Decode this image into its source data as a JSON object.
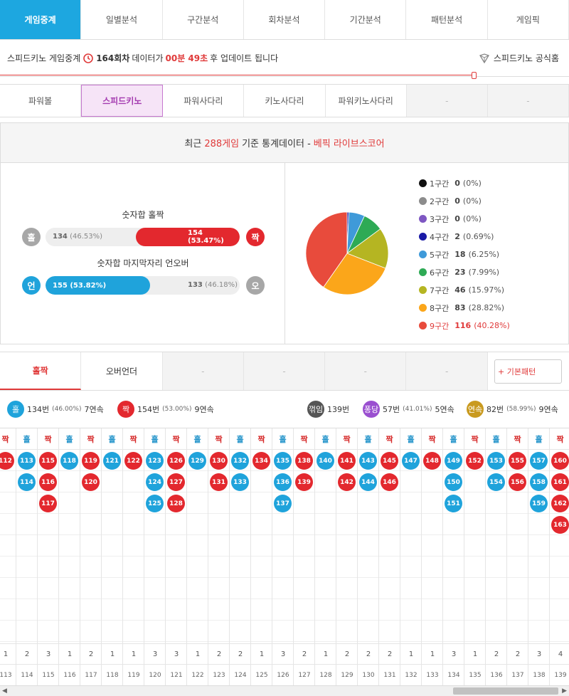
{
  "topnav": [
    "게임중계",
    "일별분석",
    "구간분석",
    "회차분석",
    "기간분석",
    "패턴분석",
    "게임픽"
  ],
  "info": {
    "prefix": "스피드키노 게임중계",
    "round": "164회차",
    "mid": "데이터가",
    "time": "00분 49초",
    "suffix": "후 업데이트 됩니다",
    "link": "스피드키노 공식홈"
  },
  "gamenav": [
    "파워볼",
    "스피드키노",
    "파워사다리",
    "키노사다리",
    "파워키노사다리",
    "-",
    "-"
  ],
  "stat": {
    "head_pre": "최근",
    "games": "288게임",
    "head_mid": "기준 통계데이터 -",
    "brand": "베픽 라이브스코어",
    "bar1": {
      "title": "숫자합 홀짝",
      "left_label": "홀",
      "right_label": "짝",
      "left_text": "134",
      "left_pct": "(46.53%)",
      "right_text": "154 (53.47%)",
      "right_fraction": 0.5347
    },
    "bar2": {
      "title": "숫자합 마지막자리 언오버",
      "left_label": "언",
      "right_label": "오",
      "left_text": "155 (53.82%)",
      "left_fraction": 0.5382,
      "right_text": "133",
      "right_pct": "(46.18%)"
    }
  },
  "chart_data": {
    "type": "pie",
    "categories": [
      "1구간",
      "2구간",
      "3구간",
      "4구간",
      "5구간",
      "6구간",
      "7구간",
      "8구간",
      "9구간"
    ],
    "values": [
      0,
      0,
      0,
      2,
      18,
      23,
      46,
      83,
      116
    ],
    "percent_labels": [
      "(0%)",
      "(0%)",
      "(0%)",
      "(0.69%)",
      "(6.25%)",
      "(7.99%)",
      "(15.97%)",
      "(28.82%)",
      "(40.28%)"
    ],
    "colors": [
      "#111111",
      "#8c8c8c",
      "#7e57c2",
      "#1a1aa6",
      "#3f9ad9",
      "#2eaa55",
      "#b5b522",
      "#fba61a",
      "#e84b3c"
    ],
    "legend": "right"
  },
  "tabs": [
    "홀짝",
    "오버언더",
    "-",
    "-",
    "-",
    "-"
  ],
  "pattern_button": "+ 기본패턴",
  "summary": {
    "odd": {
      "label": "홀",
      "count": "134번",
      "pct": "(46.00%)",
      "streak": "7연속"
    },
    "even": {
      "label": "짝",
      "count": "154번",
      "pct": "(53.00%)",
      "streak": "9연속"
    },
    "break": {
      "label": "꺾임",
      "count": "139번"
    },
    "bounce": {
      "label": "퐁당",
      "count": "57번",
      "pct": "(41.01%)",
      "streak": "5연속"
    },
    "consec": {
      "label": "연속",
      "count": "82번",
      "pct": "(58.99%)",
      "streak": "9연속"
    }
  },
  "grid": {
    "columns": [
      {
        "h": "짝",
        "t": "e",
        "n": [
          "112"
        ],
        "c": "1",
        "r": "113"
      },
      {
        "h": "홀",
        "t": "o",
        "n": [
          "113",
          "114"
        ],
        "c": "2",
        "r": "114"
      },
      {
        "h": "짝",
        "t": "e",
        "n": [
          "115",
          "116",
          "117"
        ],
        "c": "3",
        "r": "115"
      },
      {
        "h": "홀",
        "t": "o",
        "n": [
          "118"
        ],
        "c": "1",
        "r": "116"
      },
      {
        "h": "짝",
        "t": "e",
        "n": [
          "119",
          "120"
        ],
        "c": "2",
        "r": "117"
      },
      {
        "h": "홀",
        "t": "o",
        "n": [
          "121"
        ],
        "c": "1",
        "r": "118"
      },
      {
        "h": "짝",
        "t": "e",
        "n": [
          "122"
        ],
        "c": "1",
        "r": "119"
      },
      {
        "h": "홀",
        "t": "o",
        "n": [
          "123",
          "124",
          "125"
        ],
        "c": "3",
        "r": "120"
      },
      {
        "h": "짝",
        "t": "e",
        "n": [
          "126",
          "127",
          "128"
        ],
        "c": "3",
        "r": "121"
      },
      {
        "h": "홀",
        "t": "o",
        "n": [
          "129"
        ],
        "c": "1",
        "r": "122"
      },
      {
        "h": "짝",
        "t": "e",
        "n": [
          "130",
          "131"
        ],
        "c": "2",
        "r": "123"
      },
      {
        "h": "홀",
        "t": "o",
        "n": [
          "132",
          "133"
        ],
        "c": "2",
        "r": "124"
      },
      {
        "h": "짝",
        "t": "e",
        "n": [
          "134"
        ],
        "c": "1",
        "r": "125"
      },
      {
        "h": "홀",
        "t": "o",
        "n": [
          "135",
          "136",
          "137"
        ],
        "c": "3",
        "r": "126"
      },
      {
        "h": "짝",
        "t": "e",
        "n": [
          "138",
          "139"
        ],
        "c": "2",
        "r": "127"
      },
      {
        "h": "홀",
        "t": "o",
        "n": [
          "140"
        ],
        "c": "1",
        "r": "128"
      },
      {
        "h": "짝",
        "t": "e",
        "n": [
          "141",
          "142"
        ],
        "c": "2",
        "r": "129"
      },
      {
        "h": "홀",
        "t": "o",
        "n": [
          "143",
          "144"
        ],
        "c": "2",
        "r": "130"
      },
      {
        "h": "짝",
        "t": "e",
        "n": [
          "145",
          "146"
        ],
        "c": "2",
        "r": "131"
      },
      {
        "h": "홀",
        "t": "o",
        "n": [
          "147"
        ],
        "c": "1",
        "r": "132"
      },
      {
        "h": "짝",
        "t": "e",
        "n": [
          "148"
        ],
        "c": "1",
        "r": "133"
      },
      {
        "h": "홀",
        "t": "o",
        "n": [
          "149",
          "150",
          "151"
        ],
        "c": "3",
        "r": "134"
      },
      {
        "h": "짝",
        "t": "e",
        "n": [
          "152"
        ],
        "c": "1",
        "r": "135"
      },
      {
        "h": "홀",
        "t": "o",
        "n": [
          "153",
          "154"
        ],
        "c": "2",
        "r": "136"
      },
      {
        "h": "짝",
        "t": "e",
        "n": [
          "155",
          "156"
        ],
        "c": "2",
        "r": "137"
      },
      {
        "h": "홀",
        "t": "o",
        "n": [
          "157",
          "158",
          "159"
        ],
        "c": "3",
        "r": "138"
      },
      {
        "h": "짝",
        "t": "e",
        "n": [
          "160",
          "161",
          "162",
          "163"
        ],
        "c": "4",
        "r": "139"
      }
    ]
  },
  "scroll": {
    "left": "◀",
    "right": "▶"
  }
}
